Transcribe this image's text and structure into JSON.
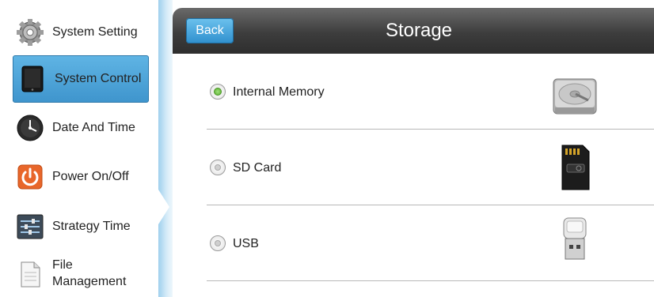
{
  "sidebar": {
    "items": [
      {
        "label": "System Setting",
        "icon": "gear-icon"
      },
      {
        "label": "System Control",
        "icon": "tablet-icon",
        "active": true
      },
      {
        "label": "Date And Time",
        "icon": "clock-icon"
      },
      {
        "label": "Power On/Off",
        "icon": "power-icon"
      },
      {
        "label": "Strategy Time",
        "icon": "sliders-icon"
      },
      {
        "label": "File\nManagement",
        "icon": "document-icon"
      }
    ]
  },
  "header": {
    "back_label": "Back",
    "title": "Storage"
  },
  "storage": {
    "options": [
      {
        "label": "Internal Memory",
        "selected": true,
        "icon": "hard-drive-icon"
      },
      {
        "label": "SD Card",
        "selected": false,
        "icon": "sd-card-icon"
      },
      {
        "label": "USB",
        "selected": false,
        "icon": "usb-drive-icon"
      }
    ]
  },
  "colors": {
    "accent": "#3f95cd",
    "header": "#3d3d3d",
    "selected_radio": "#58ad2e"
  }
}
